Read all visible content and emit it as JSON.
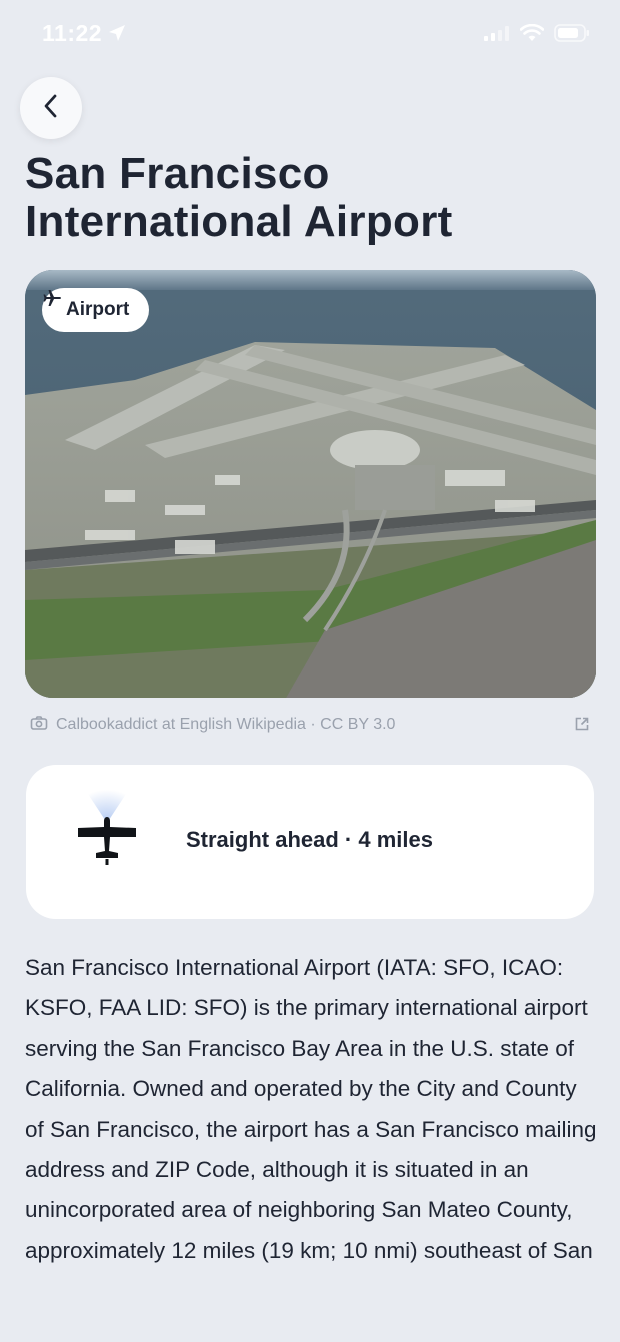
{
  "status": {
    "time": "11:22"
  },
  "header": {
    "title": "San Francisco International Airport"
  },
  "hero": {
    "badge_label": "Airport"
  },
  "credit": {
    "text": "Calbookaddict at English Wikipedia · CC BY 3.0"
  },
  "direction": {
    "text": "Straight ahead · 4 miles"
  },
  "description": "San Francisco International Airport (IATA: SFO, ICAO: KSFO, FAA LID: SFO) is the primary international airport serving the San Francisco Bay Area in the U.S. state of California. Owned and operated by the City and County of San Francisco, the airport has a San Francisco mailing address and ZIP Code, although it is situated in an unincorporated area of neighboring San Mateo County, approximately 12 miles (19 km; 10 nmi) southeast of San",
  "icons": [
    "location-arrow-icon",
    "cellular-signal-icon",
    "wifi-icon",
    "battery-icon",
    "back-arrow-icon",
    "plane-icon",
    "camera-icon",
    "external-link-icon",
    "plane-silhouette-icon"
  ]
}
